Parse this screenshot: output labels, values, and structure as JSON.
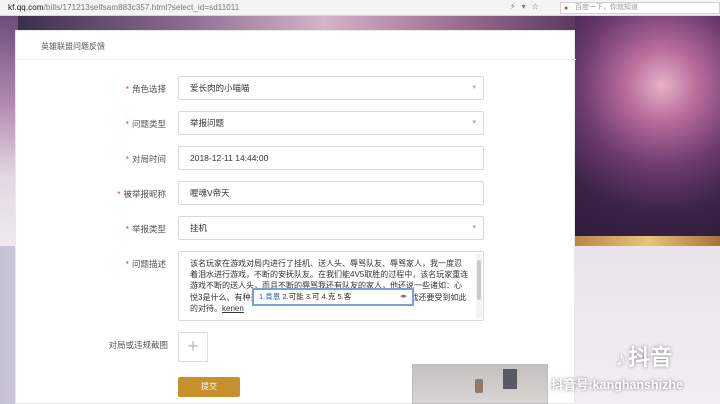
{
  "browser": {
    "url_host": "kf.qq.com",
    "url_path": "/bills/171213selfsam883c357.html?select_id=sd11011",
    "search_placeholder": "百度一下，你就知道"
  },
  "form": {
    "title": "英雄联盟问题反馈",
    "role": {
      "label": "角色选择",
      "value": "爱长肉的小喵喵"
    },
    "problem_type": {
      "label": "问题类型",
      "value": "举报问题"
    },
    "match_time": {
      "label": "对局时间",
      "value": "2018-12-11 14:44:00"
    },
    "reported_nick": {
      "label": "被举报昵称",
      "value": "喔魂V帝天"
    },
    "report_type": {
      "label": "举报类型",
      "value": "挂机"
    },
    "description": {
      "label": "问题描述",
      "text": "该名玩家在游戏对局内进行了挂机、送人头、辱骂队友、辱骂家人，我一度忍着泪水进行游戏，不断的安抚队友。在我们能4V5取胜的过程中，该名玩家重连游戏不断的送人头，而且不断的辱骂我还有队友的家人，他还说一些诸如：心悦3是什么、有种来封号的号，我不断的反思为什么我付费玩游戏还要受到如此的对待。",
      "composing": "kenen"
    },
    "screenshot": {
      "label": "对局或违规截图"
    },
    "submit_label": "提交"
  },
  "ime": {
    "candidates": [
      "1.肯恩",
      "2.可能",
      "3.可",
      "4.克",
      "5.客"
    ],
    "arrows": "◂▸"
  },
  "watermark": {
    "logo_text": "抖音",
    "account": "抖音号:kanghanshizhe"
  }
}
